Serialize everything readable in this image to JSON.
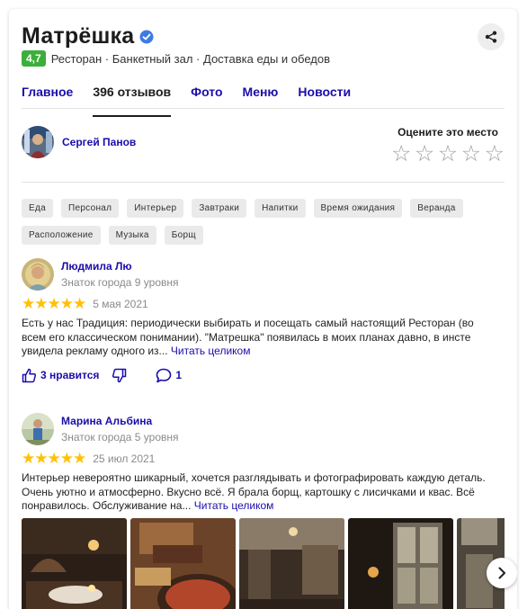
{
  "header": {
    "title": "Матрёшка",
    "rating": "4,7",
    "categories": "Ресторан · Банкетный зал · Доставка еды и обедов",
    "accent": "#3cae3a"
  },
  "tabs": [
    {
      "label": "Главное"
    },
    {
      "label": "396 отзывов"
    },
    {
      "label": "Фото"
    },
    {
      "label": "Меню"
    },
    {
      "label": "Новости"
    }
  ],
  "current_user": {
    "name": "Сергей Панов"
  },
  "rate_prompt": "Оцените это место",
  "chips": [
    "Еда",
    "Персонал",
    "Интерьер",
    "Завтраки",
    "Напитки",
    "Время ожидания",
    "Веранда",
    "Расположение",
    "Музыка",
    "Борщ"
  ],
  "reviews": [
    {
      "name": "Людмила Лю",
      "level": "Знаток города 9 уровня",
      "stars": "★★★★★",
      "rating": 5,
      "date": "5 мая 2021",
      "text": "Есть у нас Традиция: периодически выбирать и посещать самый настоящий Ресторан (во всем его классическом понимании). \"Матрешка\" появилась в моих планах давно, в инсте увидела рекламу одного из... ",
      "more": "Читать целиком",
      "likes": "3 нравится",
      "comments": "1"
    },
    {
      "name": "Марина Альбина",
      "level": "Знаток города 5 уровня",
      "stars": "★★★★★",
      "rating": 5,
      "date": "25 июл 2021",
      "text": "Интерьер невероятно шикарный, хочется разглядывать и фотографировать каждую деталь. Очень уютно и атмосферно. Вкусно всё. Я брала борщ, картошку с лисичками и квас. Всё понравилось. Обслуживание на... ",
      "more": "Читать целиком"
    }
  ],
  "colors": {
    "link": "#1a0dab",
    "star": "#ffc107",
    "verified": "#3d7be3"
  }
}
